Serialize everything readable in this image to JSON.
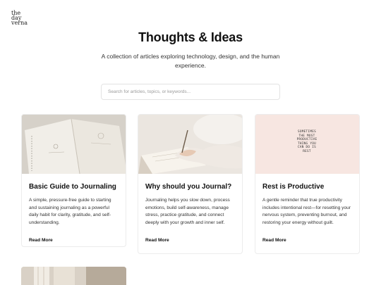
{
  "brand": {
    "logo_lines": [
      "the",
      "day",
      "verna"
    ]
  },
  "hero": {
    "title": "Thoughts & Ideas",
    "subtitle": "A collection of articles exploring technology, design, and the human experience."
  },
  "search": {
    "placeholder": "Search for articles, topics, or keywords...",
    "value": ""
  },
  "articles": [
    {
      "title": "Basic Guide to Journaling",
      "summary": "A simple, pressure-free guide to starting and sustaining journaling as a powerful daily habit for clarity, gratitude, and self-understanding.",
      "link_label": "Read More",
      "image": "open-journal-notebooks"
    },
    {
      "title": "Why should you Journal?",
      "summary": "Journaling helps you slow down, process emotions, build self-awareness, manage stress, practice gratitude, and connect deeply with your growth and inner self.",
      "link_label": "Read More",
      "image": "hand-writing-in-journal"
    },
    {
      "title": "Rest is Productive",
      "summary": "A gentle reminder that true productivity includes intentional rest—for resetting your nervous system, preventing burnout, and restoring your energy without guilt.",
      "link_label": "Read More",
      "image": "quote-card",
      "image_quote": [
        "SOMETIMES",
        "THE MOST",
        "PRODUCTIVE",
        "THING YOU",
        "CAN DO IS",
        "REST"
      ]
    },
    {
      "image": "curtained-room"
    }
  ],
  "colors": {
    "background": "#ffffff",
    "text": "#111111",
    "card_border": "#ececec",
    "quote_card_bg": "#f7e6e1"
  }
}
